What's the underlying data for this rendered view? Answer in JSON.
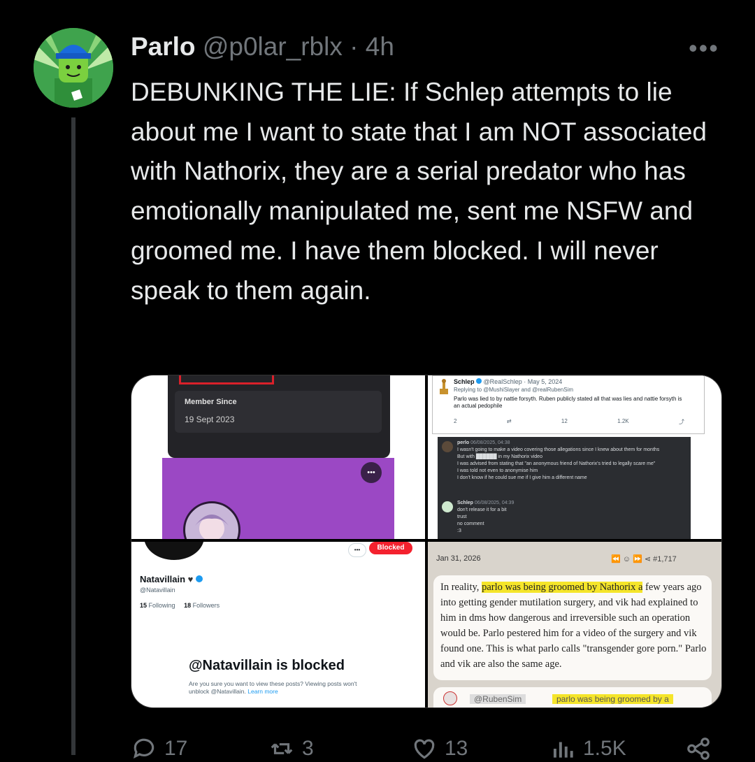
{
  "tweet": {
    "display_name": "Parlo",
    "handle": "@p0lar_rblx",
    "separator": "·",
    "time": "4h",
    "more_label": "•••",
    "text": "DEBUNKING THE LIE: If Schlep attempts to lie about me I want to state that I am NOT associated with Nathorix, they are a serial predator who has emotionally manipulated me, sent me NSFW and groomed me. I have them blocked. I will never speak to them again."
  },
  "media": {
    "profile_card": {
      "member_since_label": "Member Since",
      "member_since_value": "19 Sept 2023",
      "more": "•••"
    },
    "quoted_tweet": {
      "author": "Schlep",
      "handle": "@RealSchlep",
      "date": "· May 5, 2024",
      "replying_to": "Replying to @MushiSlayer and @realRubenSim",
      "body": "Parlo was lied to by nattie forsyth. Ruben publicly stated all that was lies and nattie forsyth is an actual pedophile",
      "stats": [
        "2",
        "",
        "12",
        "1.2K",
        ""
      ],
      "chat": [
        {
          "user": "perlo",
          "time": "06/08/2025, 04:38",
          "lines": [
            "I wasn't going to make a video covering those allegations since I knew about them for months",
            "But with ██████ in my Nathorix video",
            "I was advised from stating that \"an anonymous friend of Nathorix's tried to legally scare me\"",
            "I was told not even to anonymise him",
            "I don't know if he could sue me if I give him a different name"
          ]
        },
        {
          "user": "Schlep",
          "time": "06/08/2025, 04:39",
          "lines": [
            "don't release it for a bit",
            "trust",
            "no comment",
            ":3"
          ]
        }
      ]
    },
    "blocked_profile": {
      "name": "Natavillain",
      "handle": "@Natavillain",
      "following_count": "15",
      "following_label": "Following",
      "followers_count": "18",
      "followers_label": "Followers",
      "blocked_badge": "Blocked",
      "blocked_title": "@Natavillain is blocked",
      "blocked_sub": "Are you sure you want to view these posts? Viewing posts won't unblock @Natavillain.",
      "learn_more": "Learn more",
      "more": "•••"
    },
    "kiwi_post": {
      "date": "Jan 31, 2026",
      "post_number": "#1,717",
      "text_before": "In reality, ",
      "highlight": "parlo was being groomed by Nathorix a",
      "text_after": " few years ago into getting gender mutilation surgery, and vik had explained to him in dms how dangerous and irreversible such an operation would be. Parlo pestered him for a video of the surgery and vik found one. This is what parlo calls \"transgender gore porn.\" Parlo and vik are also the same age.",
      "quote_user": "@RubenSim",
      "quote_highlight": "parlo was being groomed by a"
    }
  },
  "actions": {
    "reply": "17",
    "retweet": "3",
    "like": "13",
    "views": "1.5K"
  },
  "colors": {
    "background": "#000000",
    "text": "#e7e9ea",
    "muted": "#71767b",
    "highlight": "#f5e52a",
    "blocked_red": "#f4212e",
    "verified_blue": "#1d9bf0"
  }
}
